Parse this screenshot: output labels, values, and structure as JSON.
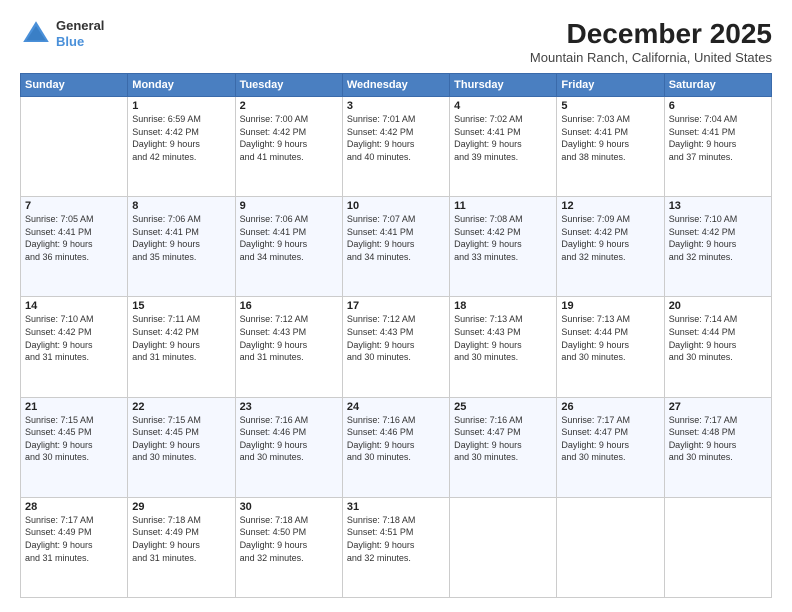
{
  "header": {
    "logo": {
      "general": "General",
      "blue": "Blue"
    },
    "title": "December 2025",
    "subtitle": "Mountain Ranch, California, United States"
  },
  "calendar": {
    "days_of_week": [
      "Sunday",
      "Monday",
      "Tuesday",
      "Wednesday",
      "Thursday",
      "Friday",
      "Saturday"
    ],
    "weeks": [
      [
        {
          "day": "",
          "content": ""
        },
        {
          "day": "1",
          "content": "Sunrise: 6:59 AM\nSunset: 4:42 PM\nDaylight: 9 hours\nand 42 minutes."
        },
        {
          "day": "2",
          "content": "Sunrise: 7:00 AM\nSunset: 4:42 PM\nDaylight: 9 hours\nand 41 minutes."
        },
        {
          "day": "3",
          "content": "Sunrise: 7:01 AM\nSunset: 4:42 PM\nDaylight: 9 hours\nand 40 minutes."
        },
        {
          "day": "4",
          "content": "Sunrise: 7:02 AM\nSunset: 4:41 PM\nDaylight: 9 hours\nand 39 minutes."
        },
        {
          "day": "5",
          "content": "Sunrise: 7:03 AM\nSunset: 4:41 PM\nDaylight: 9 hours\nand 38 minutes."
        },
        {
          "day": "6",
          "content": "Sunrise: 7:04 AM\nSunset: 4:41 PM\nDaylight: 9 hours\nand 37 minutes."
        }
      ],
      [
        {
          "day": "7",
          "content": "Sunrise: 7:05 AM\nSunset: 4:41 PM\nDaylight: 9 hours\nand 36 minutes."
        },
        {
          "day": "8",
          "content": "Sunrise: 7:06 AM\nSunset: 4:41 PM\nDaylight: 9 hours\nand 35 minutes."
        },
        {
          "day": "9",
          "content": "Sunrise: 7:06 AM\nSunset: 4:41 PM\nDaylight: 9 hours\nand 34 minutes."
        },
        {
          "day": "10",
          "content": "Sunrise: 7:07 AM\nSunset: 4:41 PM\nDaylight: 9 hours\nand 34 minutes."
        },
        {
          "day": "11",
          "content": "Sunrise: 7:08 AM\nSunset: 4:42 PM\nDaylight: 9 hours\nand 33 minutes."
        },
        {
          "day": "12",
          "content": "Sunrise: 7:09 AM\nSunset: 4:42 PM\nDaylight: 9 hours\nand 32 minutes."
        },
        {
          "day": "13",
          "content": "Sunrise: 7:10 AM\nSunset: 4:42 PM\nDaylight: 9 hours\nand 32 minutes."
        }
      ],
      [
        {
          "day": "14",
          "content": "Sunrise: 7:10 AM\nSunset: 4:42 PM\nDaylight: 9 hours\nand 31 minutes."
        },
        {
          "day": "15",
          "content": "Sunrise: 7:11 AM\nSunset: 4:42 PM\nDaylight: 9 hours\nand 31 minutes."
        },
        {
          "day": "16",
          "content": "Sunrise: 7:12 AM\nSunset: 4:43 PM\nDaylight: 9 hours\nand 31 minutes."
        },
        {
          "day": "17",
          "content": "Sunrise: 7:12 AM\nSunset: 4:43 PM\nDaylight: 9 hours\nand 30 minutes."
        },
        {
          "day": "18",
          "content": "Sunrise: 7:13 AM\nSunset: 4:43 PM\nDaylight: 9 hours\nand 30 minutes."
        },
        {
          "day": "19",
          "content": "Sunrise: 7:13 AM\nSunset: 4:44 PM\nDaylight: 9 hours\nand 30 minutes."
        },
        {
          "day": "20",
          "content": "Sunrise: 7:14 AM\nSunset: 4:44 PM\nDaylight: 9 hours\nand 30 minutes."
        }
      ],
      [
        {
          "day": "21",
          "content": "Sunrise: 7:15 AM\nSunset: 4:45 PM\nDaylight: 9 hours\nand 30 minutes."
        },
        {
          "day": "22",
          "content": "Sunrise: 7:15 AM\nSunset: 4:45 PM\nDaylight: 9 hours\nand 30 minutes."
        },
        {
          "day": "23",
          "content": "Sunrise: 7:16 AM\nSunset: 4:46 PM\nDaylight: 9 hours\nand 30 minutes."
        },
        {
          "day": "24",
          "content": "Sunrise: 7:16 AM\nSunset: 4:46 PM\nDaylight: 9 hours\nand 30 minutes."
        },
        {
          "day": "25",
          "content": "Sunrise: 7:16 AM\nSunset: 4:47 PM\nDaylight: 9 hours\nand 30 minutes."
        },
        {
          "day": "26",
          "content": "Sunrise: 7:17 AM\nSunset: 4:47 PM\nDaylight: 9 hours\nand 30 minutes."
        },
        {
          "day": "27",
          "content": "Sunrise: 7:17 AM\nSunset: 4:48 PM\nDaylight: 9 hours\nand 30 minutes."
        }
      ],
      [
        {
          "day": "28",
          "content": "Sunrise: 7:17 AM\nSunset: 4:49 PM\nDaylight: 9 hours\nand 31 minutes."
        },
        {
          "day": "29",
          "content": "Sunrise: 7:18 AM\nSunset: 4:49 PM\nDaylight: 9 hours\nand 31 minutes."
        },
        {
          "day": "30",
          "content": "Sunrise: 7:18 AM\nSunset: 4:50 PM\nDaylight: 9 hours\nand 32 minutes."
        },
        {
          "day": "31",
          "content": "Sunrise: 7:18 AM\nSunset: 4:51 PM\nDaylight: 9 hours\nand 32 minutes."
        },
        {
          "day": "",
          "content": ""
        },
        {
          "day": "",
          "content": ""
        },
        {
          "day": "",
          "content": ""
        }
      ]
    ]
  }
}
